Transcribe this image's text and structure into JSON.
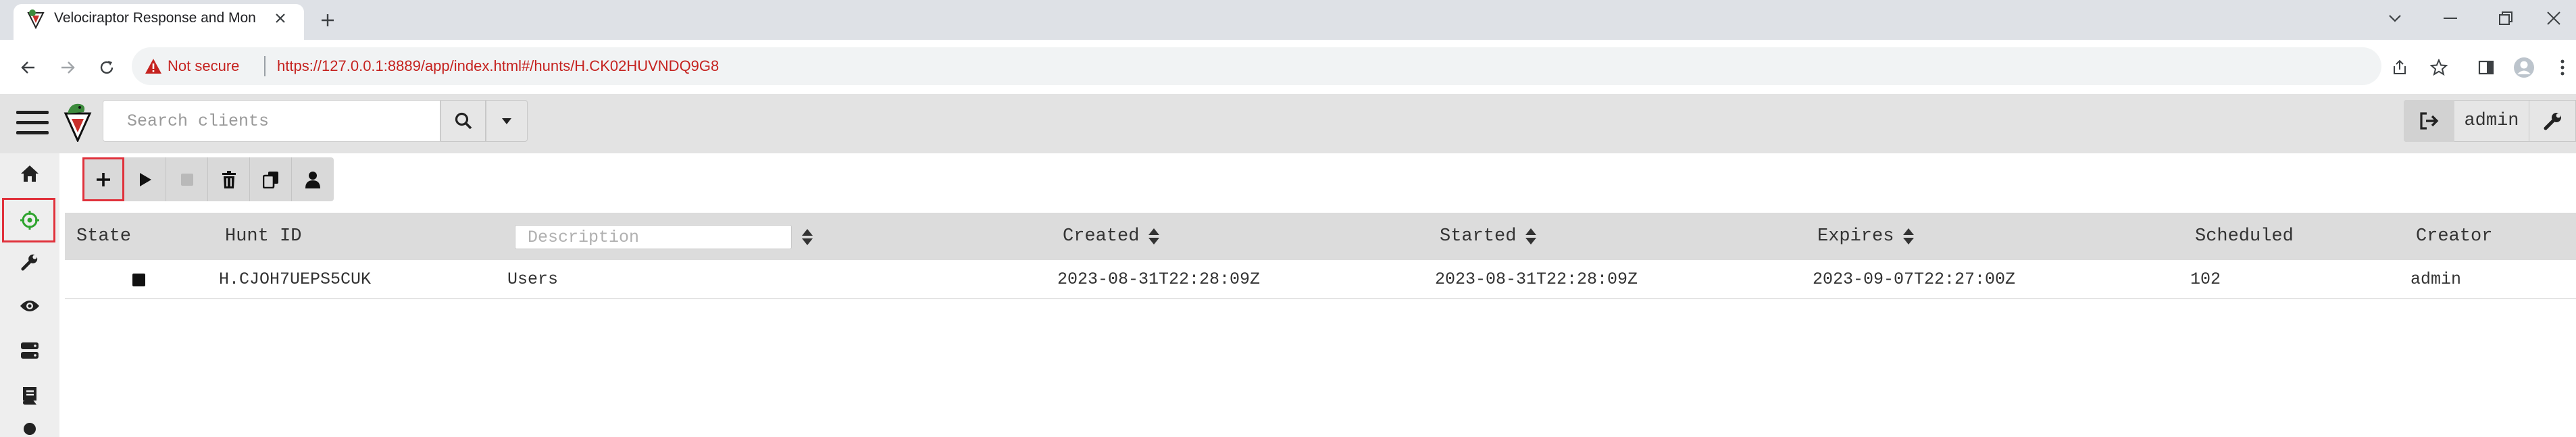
{
  "browser": {
    "tab_title": "Velociraptor Response and Monitoring",
    "not_secure_label": "Not secure",
    "url": "https://127.0.0.1:8889/app/index.html#/hunts/H.CK02HUVNDQ9G8"
  },
  "app": {
    "search_placeholder": "Search clients",
    "username": "admin"
  },
  "sidebar": {
    "items": [
      "home-icon",
      "crosshair-icon",
      "wrench-icon",
      "eye-icon",
      "server-icon",
      "book-icon",
      "more-icon"
    ],
    "active_item": "crosshair-icon"
  },
  "hunt_toolbar": {
    "buttons": [
      "new-hunt",
      "run-hunt",
      "stop-hunt",
      "delete-hunt",
      "copy-hunt",
      "assign-user"
    ]
  },
  "table": {
    "description_placeholder": "Description",
    "headers": {
      "state": "State",
      "hunt_id": "Hunt ID",
      "created": "Created",
      "started": "Started",
      "expires": "Expires",
      "scheduled": "Scheduled",
      "creator": "Creator"
    },
    "rows": [
      {
        "state": "stopped",
        "hunt_id": "H.CJOH7UEPS5CUK",
        "description": "Users",
        "created": "2023-08-31T22:28:09Z",
        "started": "2023-08-31T22:28:09Z",
        "expires": "2023-09-07T22:27:00Z",
        "scheduled": "102",
        "creator": "admin"
      }
    ]
  },
  "colors": {
    "highlight": "#e0313b",
    "insecure_red": "#c5221f"
  }
}
